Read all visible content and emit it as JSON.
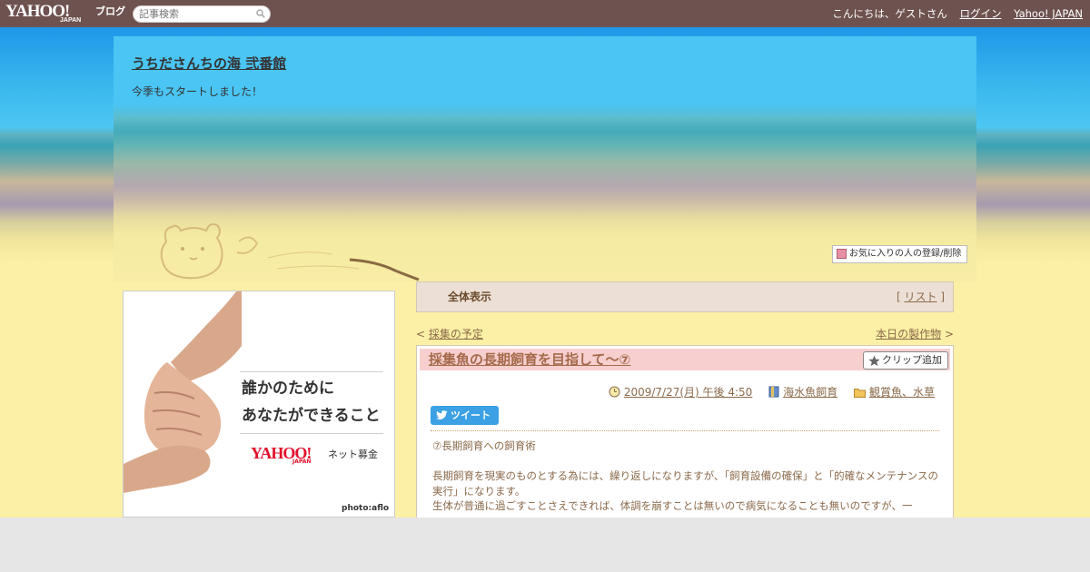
{
  "topbar": {
    "logo_main": "YAHOO!",
    "logo_sub": "JAPAN",
    "logo_blog": "ブログ",
    "search_placeholder": "記事検索",
    "greeting": "こんにちは、ゲストさん",
    "login": "ログイン",
    "yahoo_japan": "Yahoo! JAPAN"
  },
  "header": {
    "title": "うちださんちの海 弐番館",
    "description": "今季もスタートしました！",
    "fav_button": "お気に入りの人の登録/削除"
  },
  "ad": {
    "line1": "誰かのために",
    "line2": "あなたができること",
    "brand": "YAHOO!",
    "brand_sub": "JAPAN",
    "service": "ネット募金",
    "credit": "photo:aflo"
  },
  "allbar": {
    "title": "全体表示",
    "list_open": "[ ",
    "list_label": "リスト",
    "list_close": " ]"
  },
  "pager": {
    "prev_arrow": "< ",
    "prev": "採集の予定",
    "next": "本日の製作物",
    "next_arrow": " >"
  },
  "post": {
    "title": "採集魚の長期飼育を目指して～⑦",
    "clip_button": "クリップ追加",
    "datetime": "2009/7/27(月) 午後 4:50",
    "category1": "海水魚飼育",
    "category2": "観賞魚、水草",
    "tweet": "ツイート",
    "body": [
      "⑦長期飼育への飼育術",
      "",
      "長期飼育を現実のものとする為には、繰り返しになりますが、「飼育設備の確保」と「的確なメンテナンスの実行」になります。",
      "生体が普通に過ごすことさえできれば、体調を崩すことは無いので病気になることも無いのですが、一"
    ]
  }
}
